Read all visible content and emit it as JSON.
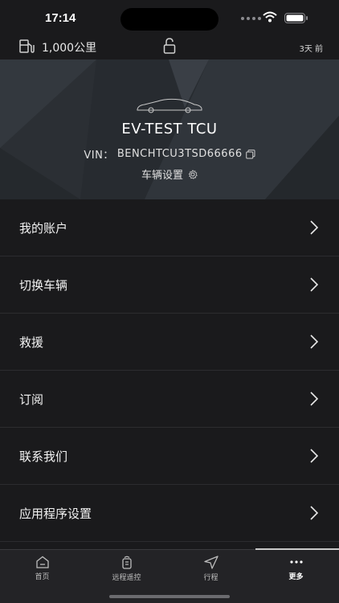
{
  "status_bar": {
    "time": "17:14"
  },
  "info_row": {
    "mileage": "1,000公里",
    "updated": "3天 前"
  },
  "vehicle": {
    "name": "EV-TEST TCU",
    "vin_label": "VIN：",
    "vin": "BENCHTCU3TSD66666",
    "settings_label": "车辆设置"
  },
  "menu": {
    "items": [
      {
        "label": "我的账户"
      },
      {
        "label": "切换车辆"
      },
      {
        "label": "救援"
      },
      {
        "label": "订阅"
      },
      {
        "label": "联系我们"
      },
      {
        "label": "应用程序设置"
      }
    ]
  },
  "bottom_nav": {
    "items": [
      {
        "label": "首页",
        "icon": "home-icon"
      },
      {
        "label": "远程遥控",
        "icon": "remote-key-icon"
      },
      {
        "label": "行程",
        "icon": "navigation-arrow-icon"
      },
      {
        "label": "更多",
        "icon": "more-dots-icon"
      }
    ],
    "active": "更多"
  },
  "colors": {
    "background": "#1a1a1c",
    "header": "#2b2f34",
    "divider": "#2c2c2f"
  }
}
